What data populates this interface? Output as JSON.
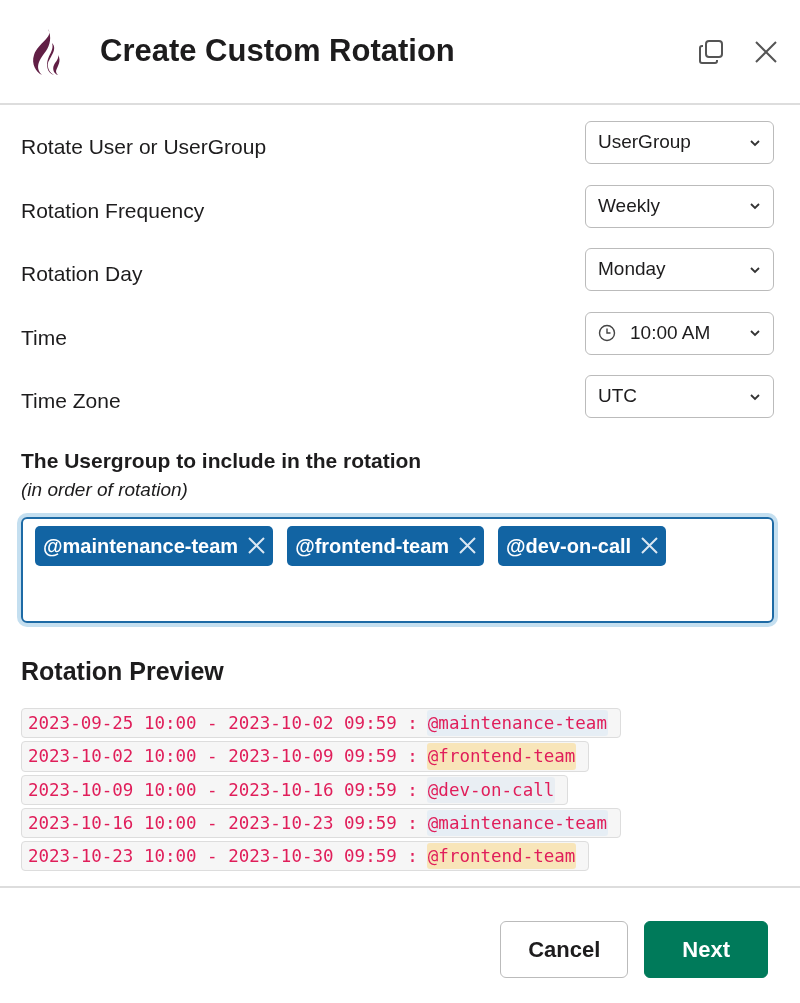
{
  "window": {
    "title": "Create Custom Rotation"
  },
  "fields": [
    {
      "label": "Rotate User or UserGroup",
      "kind": "select",
      "value": "UserGroup"
    },
    {
      "label": "Rotation Frequency",
      "kind": "select",
      "value": "Weekly"
    },
    {
      "label": "Rotation Day",
      "kind": "select",
      "value": "Monday"
    },
    {
      "label": "Time",
      "kind": "time",
      "value": "10:00 AM"
    },
    {
      "label": "Time Zone",
      "kind": "select",
      "value": "UTC"
    }
  ],
  "usergroups": {
    "label": "The Usergroup to include in the rotation",
    "hint": "(in order of rotation)",
    "tags": [
      "@maintenance-team",
      "@frontend-team",
      "@dev-on-call"
    ]
  },
  "preview": {
    "title": "Rotation Preview",
    "rows": [
      {
        "period": "2023-09-25 10:00 - 2023-10-02 09:59 :",
        "mention": "@maintenance-team",
        "color": "#e6eef5"
      },
      {
        "period": "2023-10-02 10:00 - 2023-10-09 09:59 :",
        "mention": "@frontend-team",
        "color": "#f8e5b9"
      },
      {
        "period": "2023-10-09 10:00 - 2023-10-16 09:59 :",
        "mention": "@dev-on-call",
        "color": "#e9eef3"
      },
      {
        "period": "2023-10-16 10:00 - 2023-10-23 09:59 :",
        "mention": "@maintenance-team",
        "color": "#e6eef5"
      },
      {
        "period": "2023-10-23 10:00 - 2023-10-30 09:59 :",
        "mention": "@frontend-team",
        "color": "#f8e5b9"
      }
    ]
  },
  "buttons": [
    {
      "label": "Cancel",
      "kind": "secondary"
    },
    {
      "label": "Next",
      "kind": "primary"
    }
  ]
}
